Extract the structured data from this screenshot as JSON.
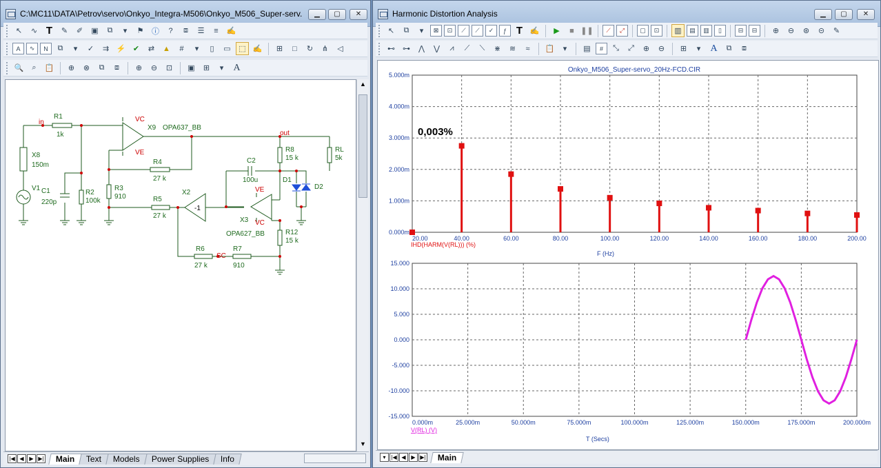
{
  "left_window": {
    "title": "C:\\MC11\\DATA\\Petrov\\servo\\Onkyo_Integra-M506\\Onkyo_M506_Super-serv...",
    "tabs": [
      "Main",
      "Text",
      "Models",
      "Power Supplies",
      "Info"
    ],
    "active_tab": "Main"
  },
  "right_window": {
    "title": "Harmonic Distortion Analysis",
    "tabs": [
      "Main"
    ],
    "active_tab": "Main"
  },
  "schematic": {
    "labels": {
      "r1": "R1",
      "r1v": "1k",
      "in": "in",
      "x8": "X8",
      "x8v": "150m",
      "v1": "V1",
      "c1": "C1",
      "c1v": "220p",
      "r2": "R2",
      "r2v": "100k",
      "r3": "R3",
      "r3v": "910",
      "r4": "R4",
      "r4v": "27 k",
      "x9": "X9",
      "x9m": "OPA637_BB",
      "vc1": "VC",
      "ve1": "VE",
      "out": "out",
      "r8": "R8",
      "r8v": "15 k",
      "rl": "RL",
      "rlv": "5k",
      "c2": "C2",
      "c2v": "100u",
      "d1": "D1",
      "d2": "D2",
      "ve2": "VE",
      "vc2": "VC",
      "x2": "X2",
      "x2g": "-1",
      "r5": "R5",
      "r5v": "27 k",
      "x3": "X3",
      "x3m": "OPA627_BB",
      "r12": "R12",
      "r12v": "15 k",
      "r6": "R6",
      "r6v": "27 k",
      "sc": "SC",
      "r7": "R7",
      "r7v": "910"
    }
  },
  "chart_data": [
    {
      "type": "bar",
      "title": "Onkyo_M506_Super-servo_20Hz-FCD.CIR",
      "xlabel": "F (Hz)",
      "ylabel": "IHD(HARM(V(RL))) (%)",
      "annotation": "0,003%",
      "xlim": [
        20,
        200
      ],
      "ylim": [
        0,
        5
      ],
      "x_ticks": [
        "20.00",
        "40.00",
        "60.00",
        "80.00",
        "100.00",
        "120.00",
        "140.00",
        "160.00",
        "180.00",
        "200.00"
      ],
      "y_ticks": [
        "0.000m",
        "1.000m",
        "2.000m",
        "3.000m",
        "4.000m",
        "5.000m"
      ],
      "x": [
        20,
        40,
        60,
        80,
        100,
        120,
        140,
        160,
        180,
        200
      ],
      "values": [
        0.0,
        2.75,
        1.85,
        1.38,
        1.1,
        0.92,
        0.78,
        0.69,
        0.6,
        0.55
      ],
      "color": "#e01010",
      "grid": true
    },
    {
      "type": "line",
      "xlabel": "T (Secs)",
      "ylabel": "V(RL) (V)",
      "xlim": [
        0,
        200
      ],
      "ylim": [
        -15,
        15
      ],
      "x_ticks": [
        "0.000m",
        "25.000m",
        "50.000m",
        "75.000m",
        "100.000m",
        "125.000m",
        "150.000m",
        "175.000m",
        "200.000m"
      ],
      "y_ticks": [
        "15.000",
        "10.000",
        "5.000",
        "0.000",
        "-5.000",
        "-10.000",
        "-15.000"
      ],
      "series": [
        {
          "x": [
            150,
            152.5,
            155,
            157.5,
            160,
            162.5,
            165,
            167.5,
            170,
            172.5,
            175,
            177.5,
            180,
            182.5,
            185,
            187.5,
            190,
            192.5,
            195,
            197.5,
            200
          ],
          "values": [
            0,
            3.86,
            7.34,
            10.1,
            11.87,
            12.5,
            11.87,
            10.1,
            7.34,
            3.86,
            0,
            -3.86,
            -7.34,
            -10.1,
            -11.87,
            -12.5,
            -11.87,
            -10.1,
            -7.34,
            -3.86,
            0
          ]
        }
      ],
      "color": "#e020e0",
      "grid": true
    }
  ]
}
